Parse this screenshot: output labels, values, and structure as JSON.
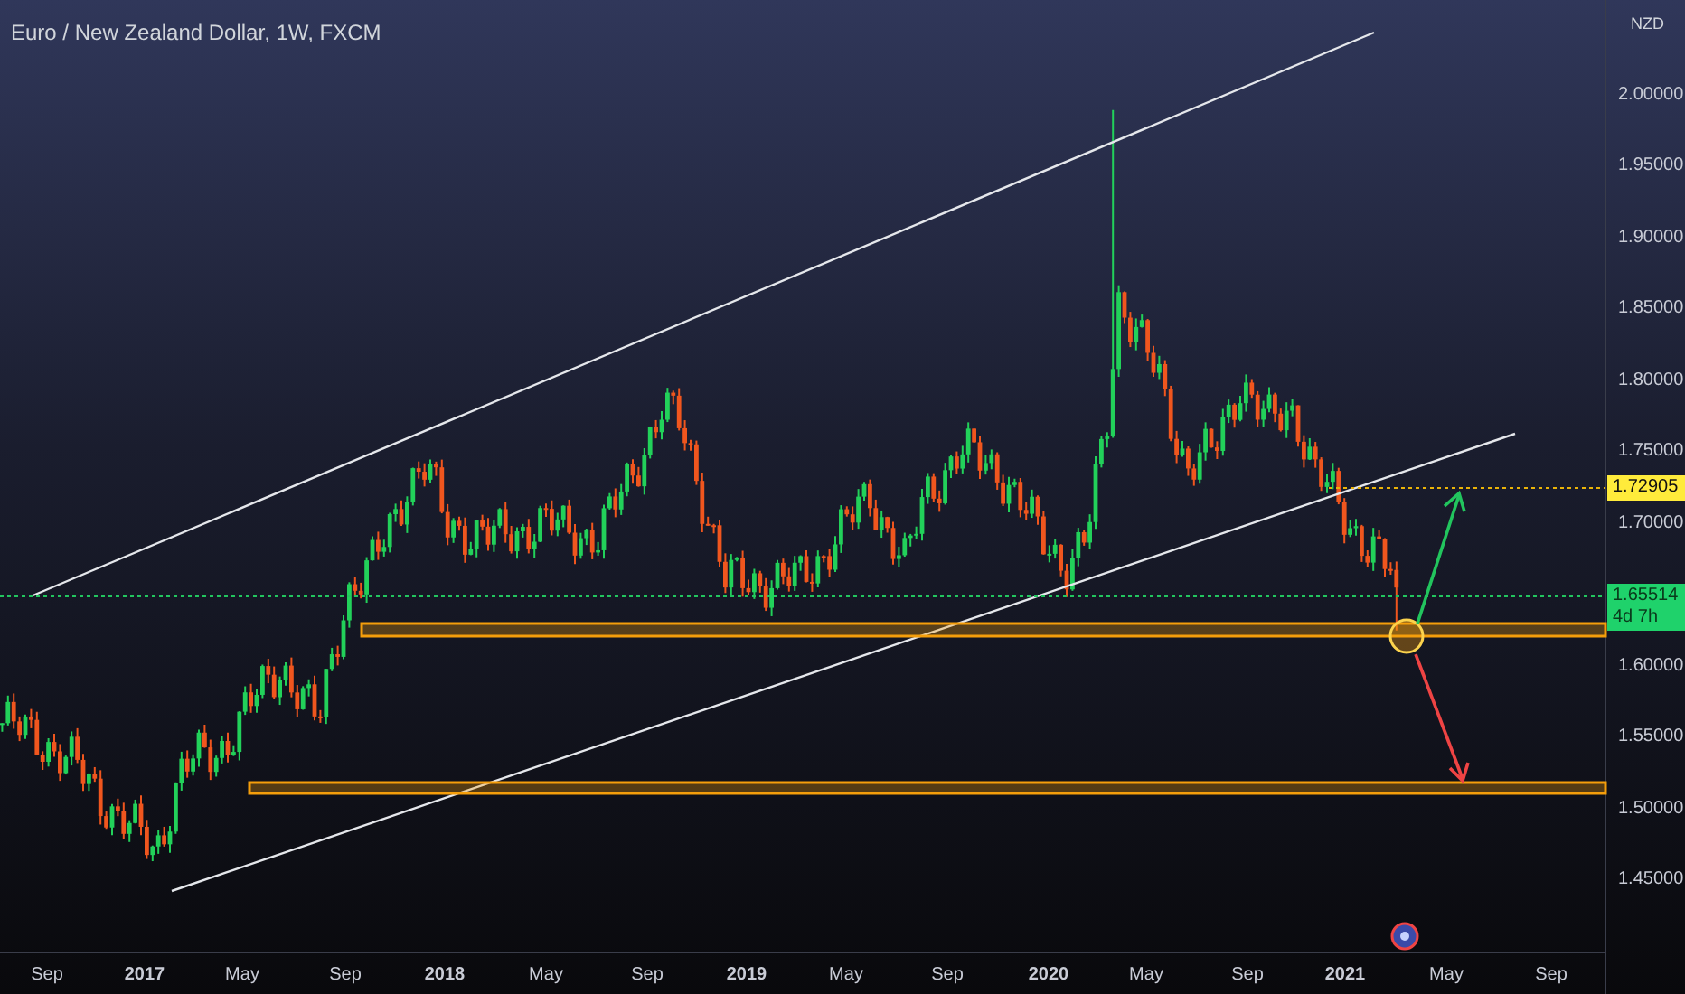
{
  "chart": {
    "title": "Euro / New Zealand Dollar, 1W, FXCM",
    "currency": "NZD",
    "price_axis": [
      "2.00000",
      "1.95000",
      "1.90000",
      "1.85000",
      "1.80000",
      "1.75000",
      "1.70000",
      "1.60000",
      "1.55000",
      "1.50000",
      "1.45000"
    ],
    "time_axis": [
      {
        "label": "Sep",
        "major": false
      },
      {
        "label": "2017",
        "major": true
      },
      {
        "label": "May",
        "major": false
      },
      {
        "label": "Sep",
        "major": false
      },
      {
        "label": "2018",
        "major": true
      },
      {
        "label": "May",
        "major": false
      },
      {
        "label": "Sep",
        "major": false
      },
      {
        "label": "2019",
        "major": true
      },
      {
        "label": "May",
        "major": false
      },
      {
        "label": "Sep",
        "major": false
      },
      {
        "label": "2020",
        "major": true
      },
      {
        "label": "May",
        "major": false
      },
      {
        "label": "Sep",
        "major": false
      },
      {
        "label": "2021",
        "major": true
      },
      {
        "label": "May",
        "major": false
      },
      {
        "label": "Sep",
        "major": false
      }
    ],
    "price_tags": [
      {
        "kind": "target",
        "price": "1.72905"
      },
      {
        "kind": "last",
        "price": "1.65514",
        "countdown": "4d 7h"
      }
    ]
  }
}
